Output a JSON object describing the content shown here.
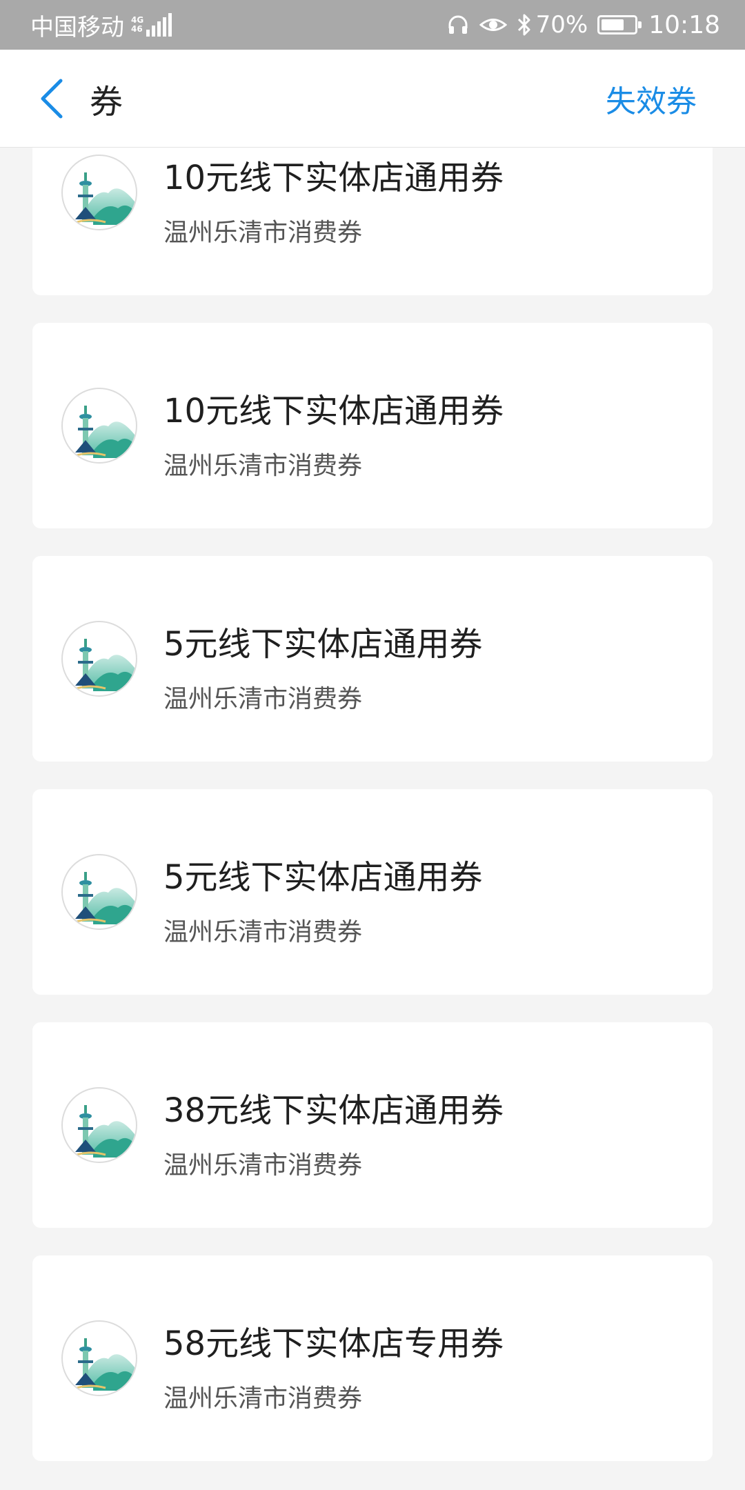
{
  "status_bar": {
    "carrier": "中国移动",
    "network": "4G",
    "network_sub": "46",
    "battery_percent": "70%",
    "battery_level": 0.7,
    "time": "10:18",
    "icons": [
      "headset-icon",
      "eye-icon",
      "bluetooth-icon",
      "battery-icon",
      "signal-icon"
    ]
  },
  "navbar": {
    "title": "券",
    "action_label": "失效券",
    "accent_color": "#1a8ce6"
  },
  "coupons": [
    {
      "title": "10元线下实体店通用券",
      "subtitle": "温州乐清市消费券"
    },
    {
      "title": "10元线下实体店通用券",
      "subtitle": "温州乐清市消费券"
    },
    {
      "title": "5元线下实体店通用券",
      "subtitle": "温州乐清市消费券"
    },
    {
      "title": "5元线下实体店通用券",
      "subtitle": "温州乐清市消费券"
    },
    {
      "title": "38元线下实体店通用券",
      "subtitle": "温州乐清市消费券"
    },
    {
      "title": "58元线下实体店专用券",
      "subtitle": "温州乐清市消费券"
    }
  ]
}
